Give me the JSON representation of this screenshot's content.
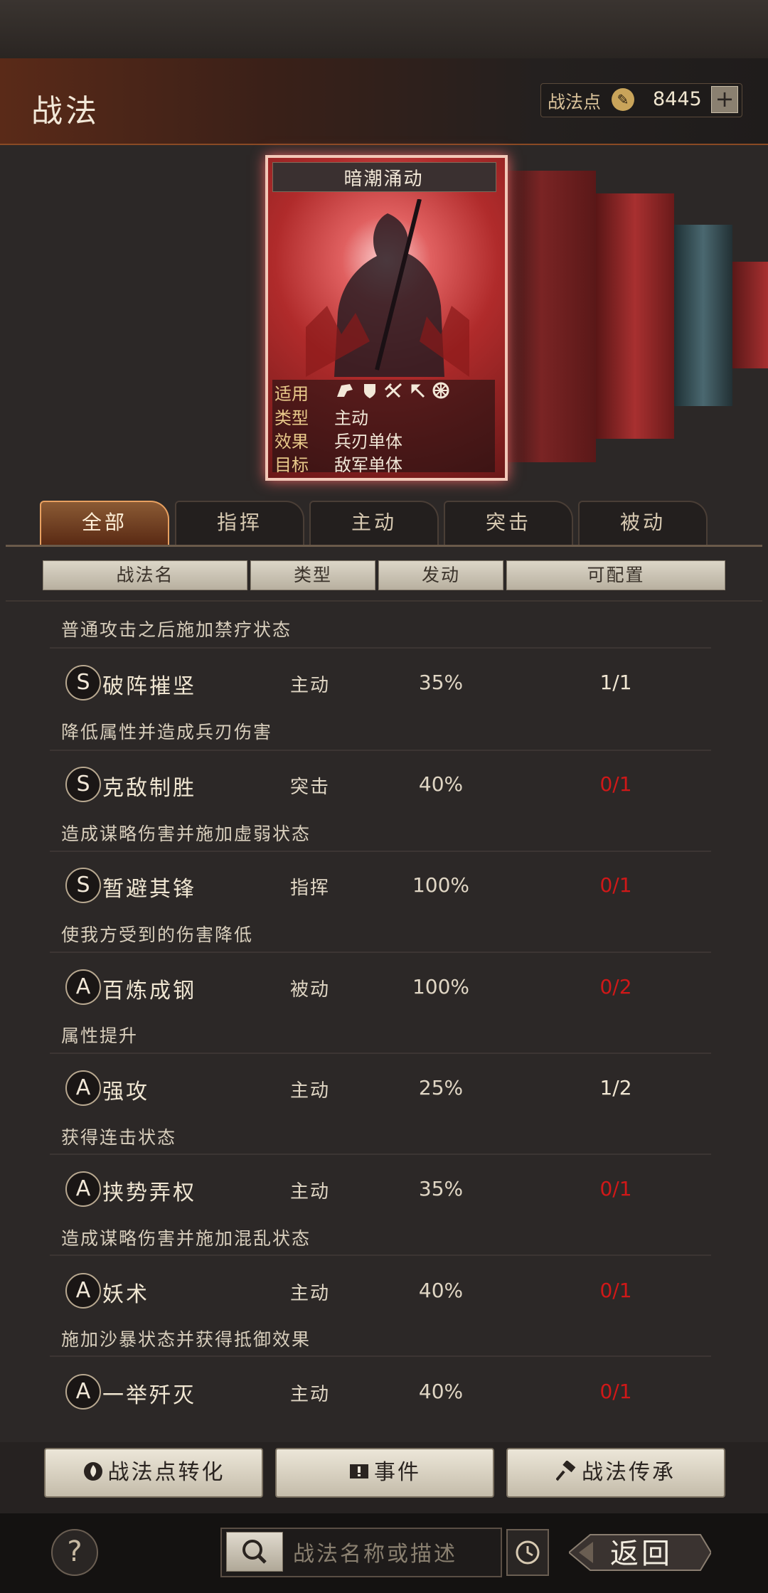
{
  "header": {
    "title": "战法",
    "points_label": "战法点",
    "points_value": "8445",
    "add_symbol": "+"
  },
  "featured_card": {
    "title": "暗潮涌动",
    "rows": [
      {
        "key": "适用",
        "value": ""
      },
      {
        "key": "类型",
        "value": "主动"
      },
      {
        "key": "效果",
        "value": "兵刃单体"
      },
      {
        "key": "目标",
        "value": "敌军单体"
      }
    ],
    "applicable_icons": [
      "cavalry-icon",
      "shield-icon",
      "bow-icon",
      "spear-icon",
      "chariot-icon"
    ]
  },
  "tabs": [
    {
      "label": "全部",
      "active": true
    },
    {
      "label": "指挥",
      "active": false
    },
    {
      "label": "主动",
      "active": false
    },
    {
      "label": "突击",
      "active": false
    },
    {
      "label": "被动",
      "active": false
    }
  ],
  "columns": [
    "战法名",
    "类型",
    "发动",
    "可配置"
  ],
  "intro_desc": "普通攻击之后施加禁疗状态",
  "tactics": [
    {
      "grade": "S",
      "name": "破阵摧坚",
      "type": "主动",
      "rate": "35%",
      "config": "1/1",
      "config_red": false,
      "desc": "降低属性并造成兵刃伤害"
    },
    {
      "grade": "S",
      "name": "克敌制胜",
      "type": "突击",
      "rate": "40%",
      "config": "0/1",
      "config_red": true,
      "desc": "造成谋略伤害并施加虚弱状态"
    },
    {
      "grade": "S",
      "name": "暂避其锋",
      "type": "指挥",
      "rate": "100%",
      "config": "0/1",
      "config_red": true,
      "desc": "使我方受到的伤害降低"
    },
    {
      "grade": "A",
      "name": "百炼成钢",
      "type": "被动",
      "rate": "100%",
      "config": "0/2",
      "config_red": true,
      "desc": "属性提升"
    },
    {
      "grade": "A",
      "name": "强攻",
      "type": "主动",
      "rate": "25%",
      "config": "1/2",
      "config_red": false,
      "desc": "获得连击状态"
    },
    {
      "grade": "A",
      "name": "挟势弄权",
      "type": "主动",
      "rate": "35%",
      "config": "0/1",
      "config_red": true,
      "desc": "造成谋略伤害并施加混乱状态"
    },
    {
      "grade": "A",
      "name": "妖术",
      "type": "主动",
      "rate": "40%",
      "config": "0/1",
      "config_red": true,
      "desc": "施加沙暴状态并获得抵御效果"
    },
    {
      "grade": "A",
      "name": "一举歼灭",
      "type": "主动",
      "rate": "40%",
      "config": "0/1",
      "config_red": true,
      "desc": ""
    }
  ],
  "actions": {
    "convert_label": "战法点转化",
    "events_label": "事件",
    "inherit_label": "战法传承"
  },
  "footer": {
    "help_symbol": "?",
    "search_placeholder": "战法名称或描述",
    "return_label": "返回"
  },
  "colors": {
    "accent": "#e8a060",
    "config_red": "#d01818",
    "header_warm": "#5a2a18"
  }
}
